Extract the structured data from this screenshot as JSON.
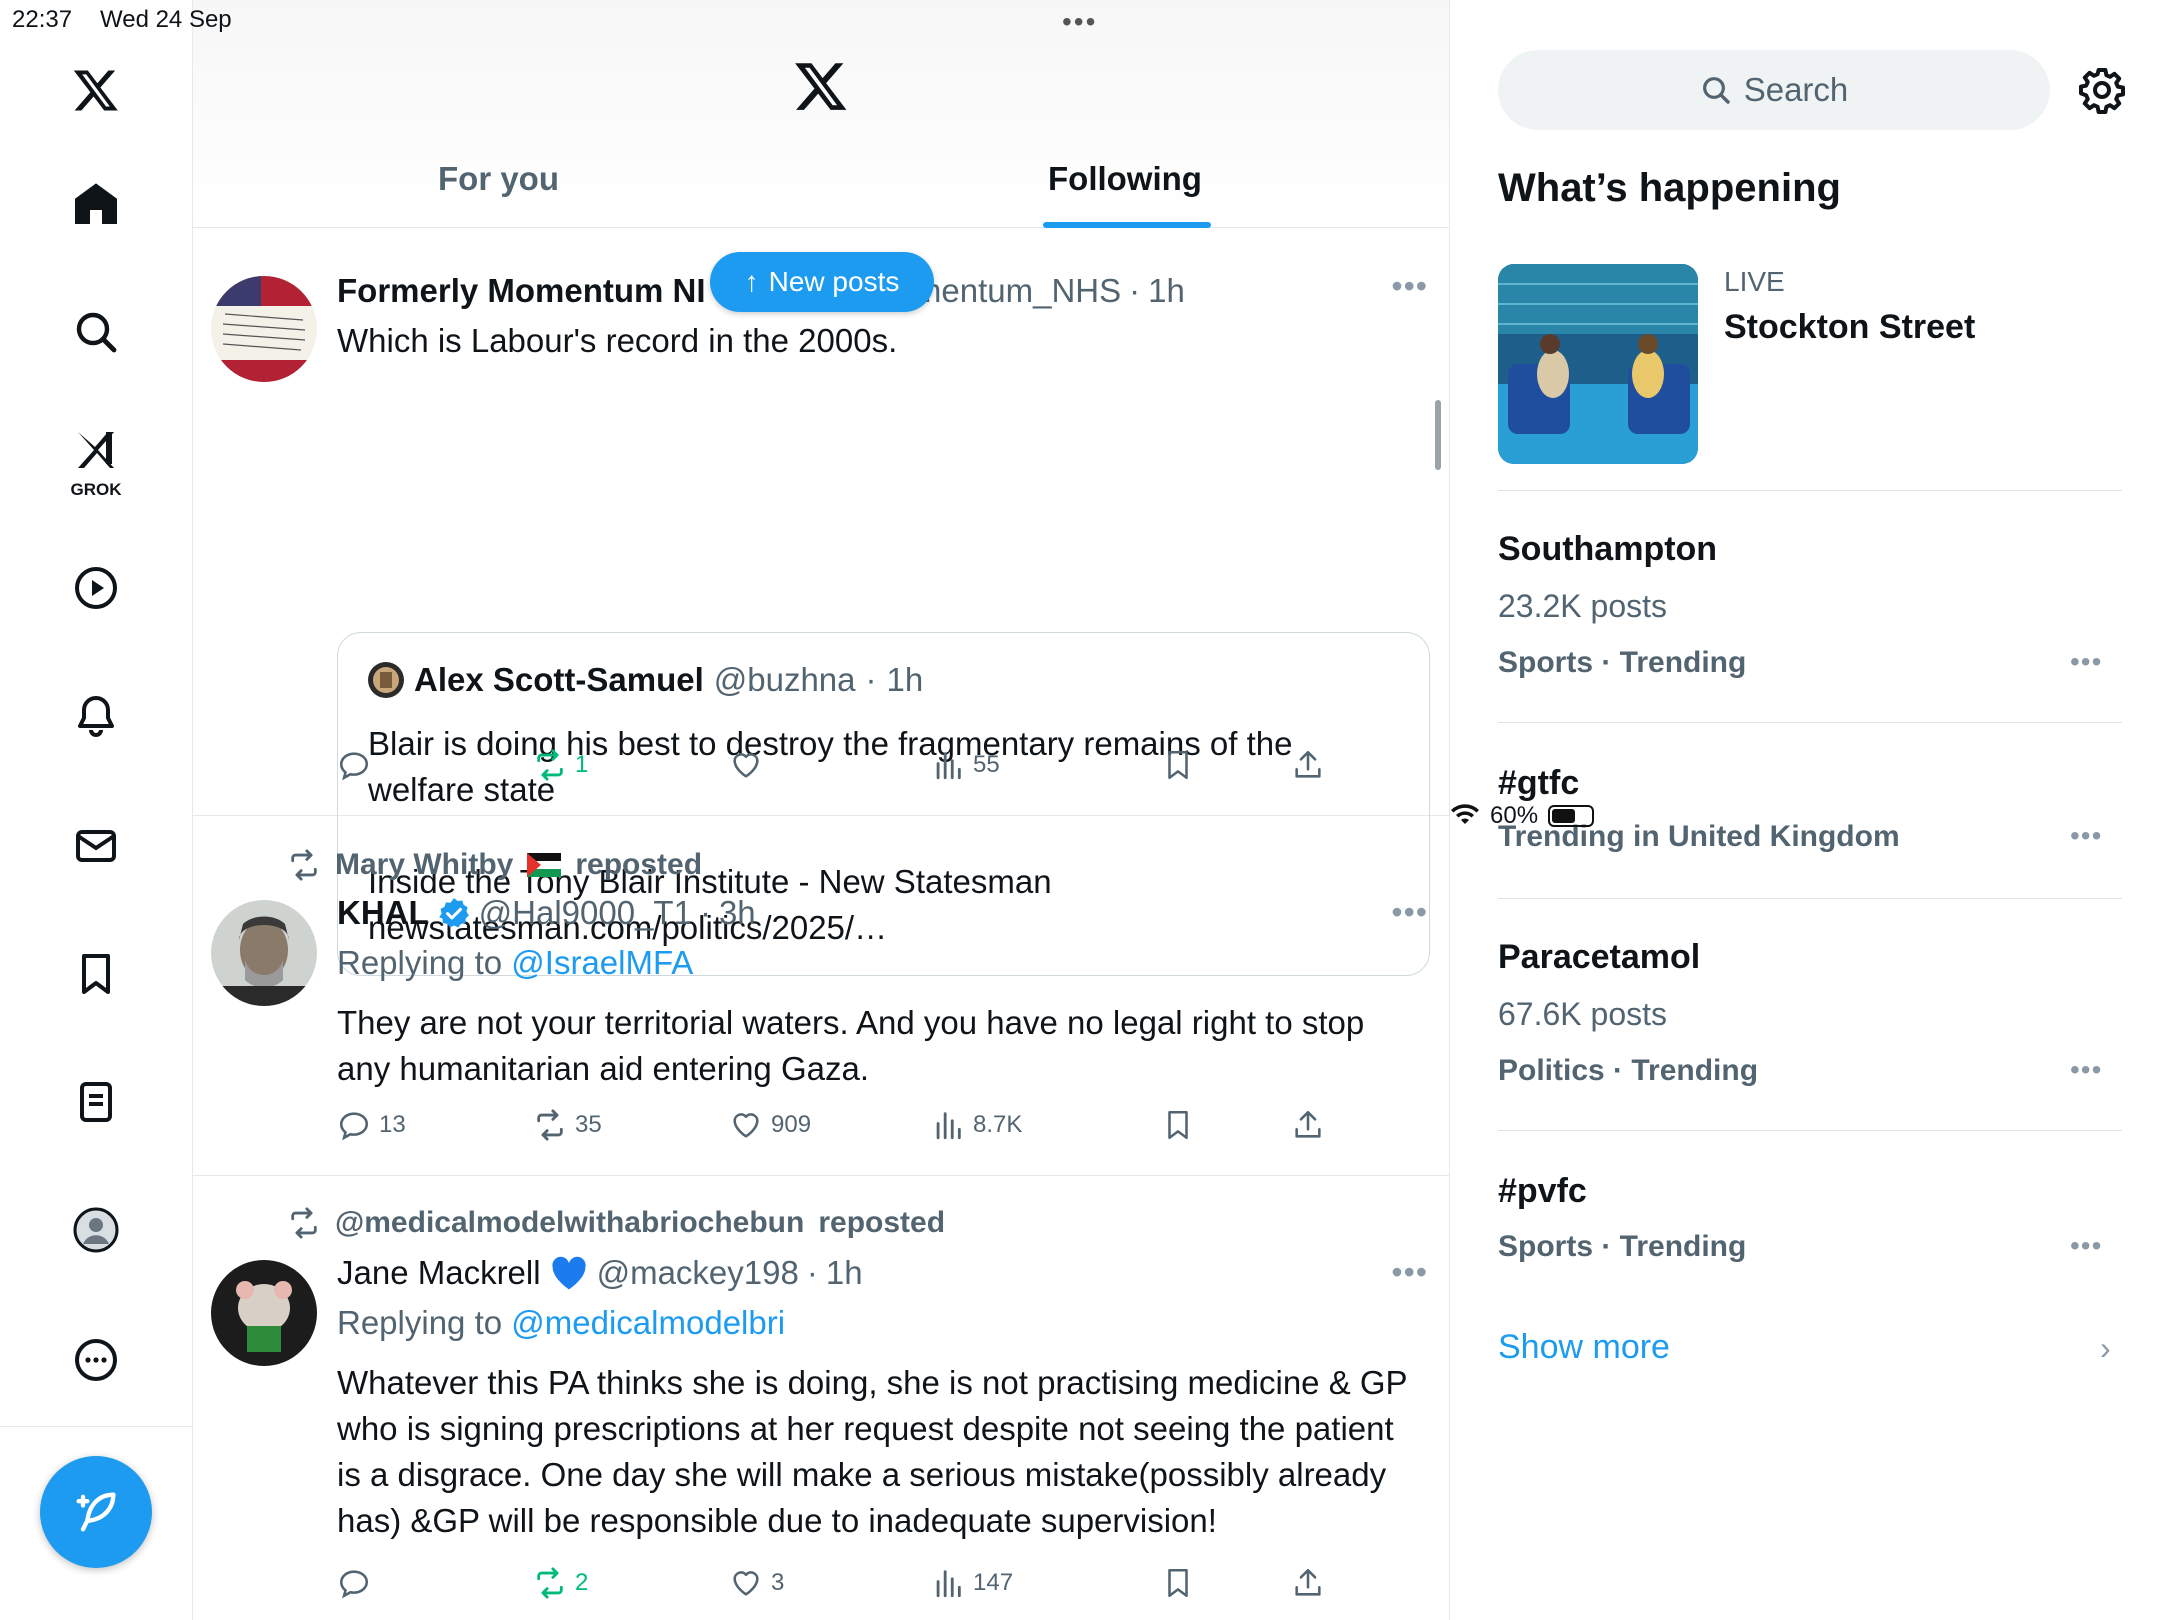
{
  "status_bar": {
    "time": "22:37",
    "date": "Wed 24 Sep",
    "battery": "60%",
    "battery_level": 0.6
  },
  "nav": {
    "grok_label": "GROK"
  },
  "header": {
    "tabs": [
      {
        "label": "For you"
      },
      {
        "label": "Following"
      }
    ]
  },
  "new_posts_label": "New posts",
  "posts": [
    {
      "name": "Formerly Momentum NHS",
      "name_visible": "Formerly Momentum NI",
      "handle_visible": "xMomentum_NHS",
      "time": "1h",
      "text": "Which is Labour's record in the 2000s.",
      "quote": {
        "name": "Alex Scott-Samuel",
        "handle": "@buzhna",
        "time": "1h",
        "text_1": "Blair is doing his best to destroy the fragmentary remains of the welfare state",
        "text_2": "Inside the Tony Blair Institute - New Statesman",
        "text_3": "newstatesman.com/politics/2025/…"
      },
      "actions": {
        "replies": "",
        "reposts": "1",
        "likes": "",
        "views": "55"
      }
    },
    {
      "reposted_by": "Mary Whitby",
      "reposted_suffix": "reposted",
      "name": "KHAL",
      "handle": "@Hal9000_T1",
      "time": "3h",
      "replying_prefix": "Replying to",
      "replying_to": "@IsraelMFA",
      "text": "They are not your territorial waters. And you have no legal right to stop any humanitarian aid entering Gaza.",
      "actions": {
        "replies": "13",
        "reposts": "35",
        "likes": "909",
        "views": "8.7K"
      }
    },
    {
      "reposted_by": "@medicalmodelwithabriochebun",
      "reposted_suffix": "reposted",
      "name": "Jane Mackrell",
      "handle": "@mackey198",
      "time": "1h",
      "replying_prefix": "Replying to",
      "replying_to": "@medicalmodelbri",
      "text": "Whatever this PA thinks she is doing, she is not practising medicine & GP who is signing prescriptions at her request despite not seeing the patient is a disgrace. One day she will make a serious mistake(possibly already has) &GP will be responsible due to inadequate supervision!",
      "actions": {
        "replies": "",
        "reposts": "2",
        "likes": "3",
        "views": "147"
      }
    }
  ],
  "sidebar": {
    "search_placeholder": "Search",
    "whats_happening": "What’s happening",
    "live": {
      "label": "LIVE",
      "title": "Stockton Street"
    },
    "trends": [
      {
        "title": "Southampton",
        "posts": "23.2K posts",
        "category": "Sports · Trending"
      },
      {
        "title": "#gtfc",
        "posts": "",
        "category": "Trending in United Kingdom"
      },
      {
        "title": "Paracetamol",
        "posts": "67.6K posts",
        "category": "Politics · Trending"
      },
      {
        "title": "#pvfc",
        "posts": "",
        "category": "Sports · Trending"
      }
    ],
    "show_more": "Show more"
  },
  "colors": {
    "accent": "#1d9bf0",
    "repost_green": "#00ba7c",
    "secondary_text": "#536471"
  }
}
